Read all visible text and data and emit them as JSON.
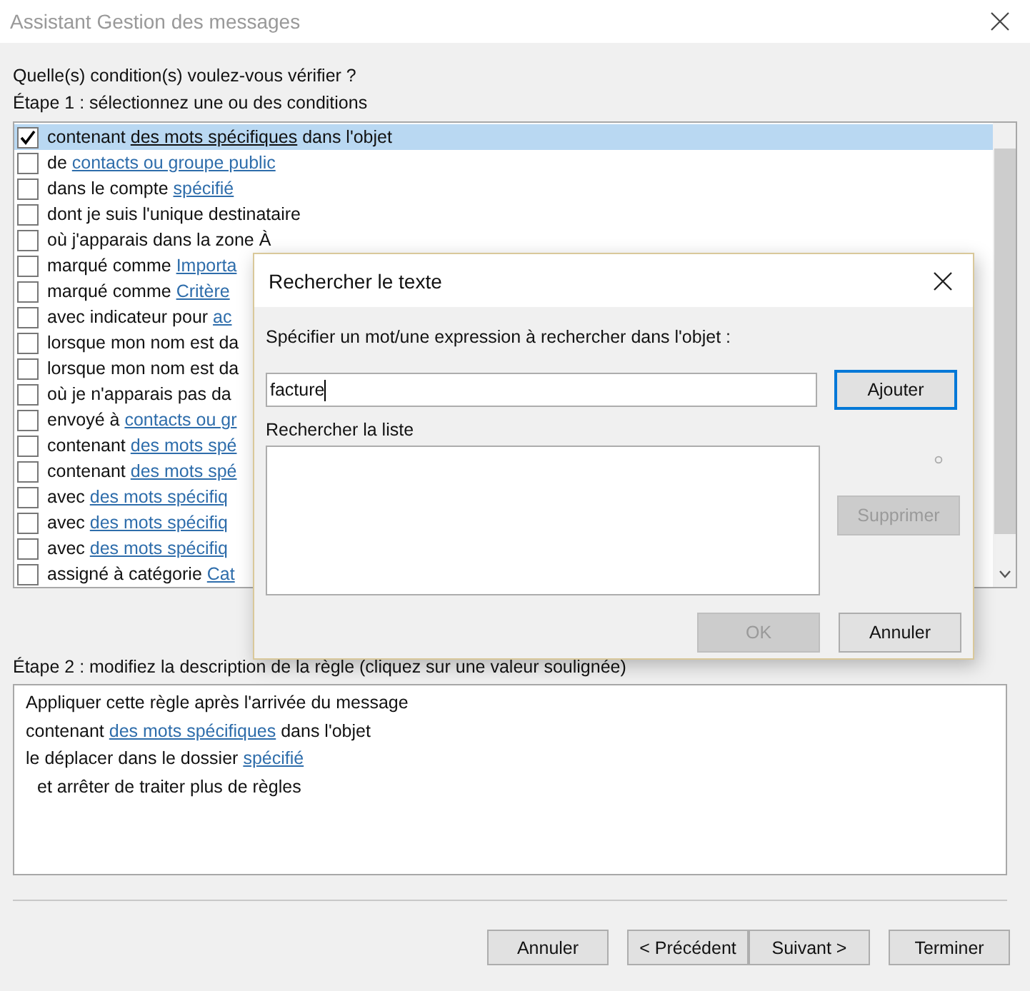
{
  "window": {
    "title": "Assistant Gestion des messages"
  },
  "question": "Quelle(s) condition(s) voulez-vous vérifier ?",
  "step1": "Étape 1 : sélectionnez une ou des conditions",
  "conditions": [
    {
      "checked": true,
      "selected": true,
      "parts": [
        {
          "kind": "plain",
          "text": "contenant "
        },
        {
          "kind": "link",
          "text": "des mots spécifiques"
        },
        {
          "kind": "plain",
          "text": " dans l'objet"
        }
      ]
    },
    {
      "checked": false,
      "selected": false,
      "parts": [
        {
          "kind": "plain",
          "text": "de "
        },
        {
          "kind": "link",
          "text": "contacts ou groupe public"
        }
      ]
    },
    {
      "checked": false,
      "selected": false,
      "parts": [
        {
          "kind": "plain",
          "text": "dans le compte "
        },
        {
          "kind": "link",
          "text": "spécifié"
        }
      ]
    },
    {
      "checked": false,
      "selected": false,
      "parts": [
        {
          "kind": "plain",
          "text": "dont je suis l'unique destinataire"
        }
      ]
    },
    {
      "checked": false,
      "selected": false,
      "parts": [
        {
          "kind": "plain",
          "text": "où j'apparais dans la zone À"
        }
      ]
    },
    {
      "checked": false,
      "selected": false,
      "parts": [
        {
          "kind": "plain",
          "text": "marqué comme "
        },
        {
          "kind": "link",
          "text": "Importa"
        }
      ]
    },
    {
      "checked": false,
      "selected": false,
      "parts": [
        {
          "kind": "plain",
          "text": "marqué comme "
        },
        {
          "kind": "link",
          "text": "Critère"
        }
      ]
    },
    {
      "checked": false,
      "selected": false,
      "parts": [
        {
          "kind": "plain",
          "text": "avec indicateur pour "
        },
        {
          "kind": "link",
          "text": "ac"
        }
      ]
    },
    {
      "checked": false,
      "selected": false,
      "parts": [
        {
          "kind": "plain",
          "text": "lorsque mon nom est da"
        }
      ]
    },
    {
      "checked": false,
      "selected": false,
      "parts": [
        {
          "kind": "plain",
          "text": "lorsque mon nom est da"
        }
      ]
    },
    {
      "checked": false,
      "selected": false,
      "parts": [
        {
          "kind": "plain",
          "text": "où je n'apparais pas da"
        }
      ]
    },
    {
      "checked": false,
      "selected": false,
      "parts": [
        {
          "kind": "plain",
          "text": "envoyé à "
        },
        {
          "kind": "link",
          "text": "contacts ou gr"
        }
      ]
    },
    {
      "checked": false,
      "selected": false,
      "parts": [
        {
          "kind": "plain",
          "text": "contenant "
        },
        {
          "kind": "link",
          "text": "des mots spé"
        }
      ]
    },
    {
      "checked": false,
      "selected": false,
      "parts": [
        {
          "kind": "plain",
          "text": "contenant "
        },
        {
          "kind": "link",
          "text": "des mots spé"
        }
      ]
    },
    {
      "checked": false,
      "selected": false,
      "parts": [
        {
          "kind": "plain",
          "text": "avec "
        },
        {
          "kind": "link",
          "text": "des mots spécifiq"
        }
      ]
    },
    {
      "checked": false,
      "selected": false,
      "parts": [
        {
          "kind": "plain",
          "text": "avec "
        },
        {
          "kind": "link",
          "text": "des mots spécifiq"
        }
      ]
    },
    {
      "checked": false,
      "selected": false,
      "parts": [
        {
          "kind": "plain",
          "text": "avec "
        },
        {
          "kind": "link",
          "text": "des mots spécifiq"
        }
      ]
    },
    {
      "checked": false,
      "selected": false,
      "parts": [
        {
          "kind": "plain",
          "text": "assigné à catégorie "
        },
        {
          "kind": "link",
          "text": "Cat"
        }
      ]
    }
  ],
  "step2": "Étape 2 : modifiez la description de la règle (cliquez sur une valeur soulignée)",
  "description": [
    {
      "indent": false,
      "parts": [
        {
          "kind": "plain",
          "text": "Appliquer cette règle après l'arrivée du message"
        }
      ]
    },
    {
      "indent": false,
      "parts": [
        {
          "kind": "plain",
          "text": "contenant "
        },
        {
          "kind": "link",
          "text": "des mots spécifiques"
        },
        {
          "kind": "plain",
          "text": " dans l'objet"
        }
      ]
    },
    {
      "indent": false,
      "parts": [
        {
          "kind": "plain",
          "text": "le déplacer dans le dossier "
        },
        {
          "kind": "link",
          "text": "spécifié"
        }
      ]
    },
    {
      "indent": true,
      "parts": [
        {
          "kind": "plain",
          "text": "et arrêter de traiter plus de règles"
        }
      ]
    }
  ],
  "buttons": [
    {
      "label": "Annuler",
      "gap": false
    },
    {
      "label": "< Précédent",
      "gap": true
    },
    {
      "label": "Suivant >",
      "gap": false
    },
    {
      "label": "Terminer",
      "gap": true
    }
  ],
  "dialog": {
    "title": "Rechercher le texte",
    "prompt": "Spécifier un mot/une expression à rechercher dans l'objet :",
    "value": "facture",
    "add": {
      "label": "Ajouter",
      "disabled": false
    },
    "list_label": "Rechercher la liste",
    "remove": {
      "label": "Supprimer",
      "disabled": true
    },
    "ok": {
      "label": "OK",
      "disabled": true
    },
    "cancel": {
      "label": "Annuler",
      "disabled": false
    }
  }
}
